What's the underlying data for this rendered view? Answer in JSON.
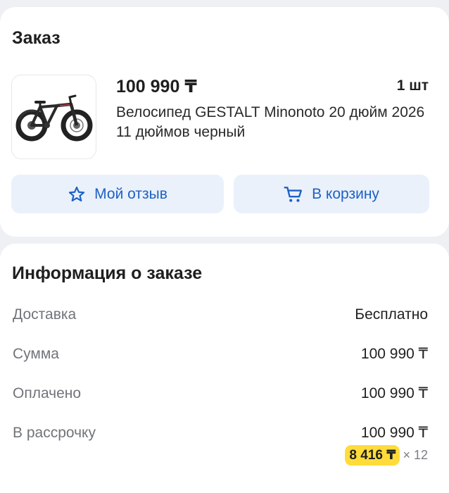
{
  "order": {
    "heading": "Заказ",
    "item": {
      "price": "100 990 ₸",
      "quantity": "1 шт",
      "title": "Велосипед GESTALT Minonoto 20 дюйм 2026 11 дюймов черный"
    },
    "review_button": "Мой отзыв",
    "cart_button": "В корзину"
  },
  "info": {
    "heading": "Информация о заказе",
    "rows": [
      {
        "label": "Доставка",
        "value": "Бесплатно"
      },
      {
        "label": "Сумма",
        "value": "100 990 ₸"
      },
      {
        "label": "Оплачено",
        "value": "100 990 ₸"
      },
      {
        "label": "В рассрочку",
        "value": "100 990 ₸"
      }
    ],
    "installment": {
      "monthly": "8 416 ₸",
      "times": "× 12"
    }
  },
  "colors": {
    "accent": "#1e61c4",
    "button_bg": "#eaf1fb",
    "badge": "#ffdc3a"
  },
  "icons": {
    "review": "star-outline-icon",
    "cart": "cart-icon",
    "product": "bicycle-image"
  }
}
